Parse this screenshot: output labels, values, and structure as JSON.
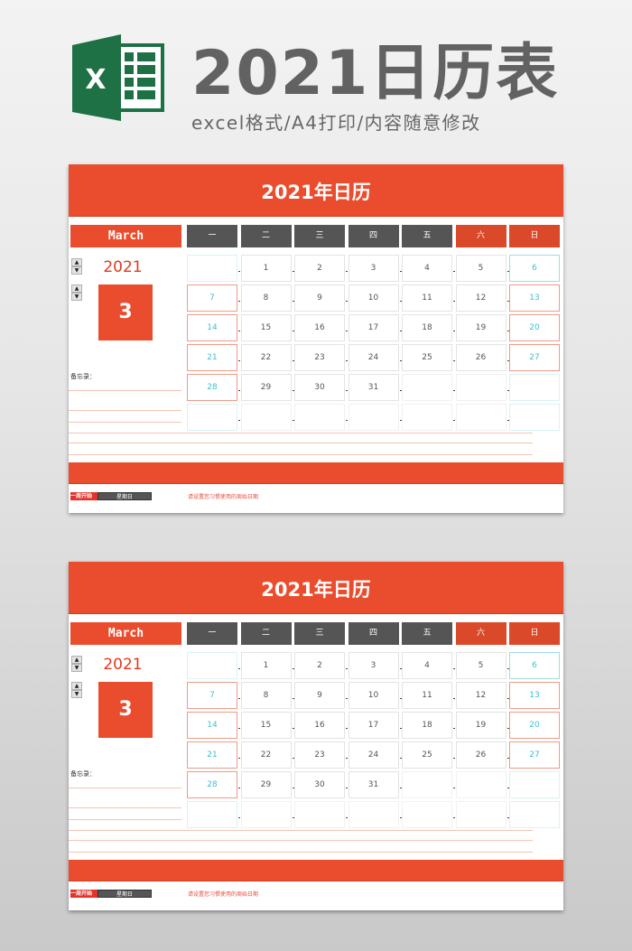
{
  "banner": {
    "logo_letter": "X",
    "title": "2021日历表",
    "subtitle": "excel格式/A4打印/内容随意修改",
    "logo_color": "#1e7145"
  },
  "colors": {
    "accent": "#ea4d2e",
    "header_gray": "#555555",
    "weekend_text": "#3dbfcf"
  },
  "calendars": [
    {
      "title": "2021年日历",
      "month_name": "March",
      "year": "2021",
      "month_number": "3",
      "memo_label": "备忘录：",
      "weekdays": [
        "一",
        "二",
        "三",
        "四",
        "五",
        "六",
        "日"
      ],
      "weeks": [
        [
          "",
          "1",
          "2",
          "3",
          "4",
          "5",
          "6"
        ],
        [
          "7",
          "8",
          "9",
          "10",
          "11",
          "12",
          "13"
        ],
        [
          "14",
          "15",
          "16",
          "17",
          "18",
          "19",
          "20"
        ],
        [
          "21",
          "22",
          "23",
          "24",
          "25",
          "26",
          "27"
        ],
        [
          "28",
          "29",
          "30",
          "31",
          "",
          "",
          ""
        ],
        [
          "",
          "",
          "",
          "",
          "",
          "",
          ""
        ]
      ],
      "week_start_label": "一周开始",
      "week_start_value": "星期日",
      "hint": "请设置您习惯使用的周始日期"
    },
    {
      "title": "2021年日历",
      "month_name": "March",
      "year": "2021",
      "month_number": "3",
      "memo_label": "备忘录：",
      "weekdays": [
        "一",
        "二",
        "三",
        "四",
        "五",
        "六",
        "日"
      ],
      "weeks": [
        [
          "",
          "1",
          "2",
          "3",
          "4",
          "5",
          "6"
        ],
        [
          "7",
          "8",
          "9",
          "10",
          "11",
          "12",
          "13"
        ],
        [
          "14",
          "15",
          "16",
          "17",
          "18",
          "19",
          "20"
        ],
        [
          "21",
          "22",
          "23",
          "24",
          "25",
          "26",
          "27"
        ],
        [
          "28",
          "29",
          "30",
          "31",
          "",
          "",
          ""
        ],
        [
          "",
          "",
          "",
          "",
          "",
          "",
          ""
        ]
      ],
      "week_start_label": "一周开始",
      "week_start_value": "星期日",
      "hint": "请设置您习惯使用的周始日期"
    }
  ]
}
